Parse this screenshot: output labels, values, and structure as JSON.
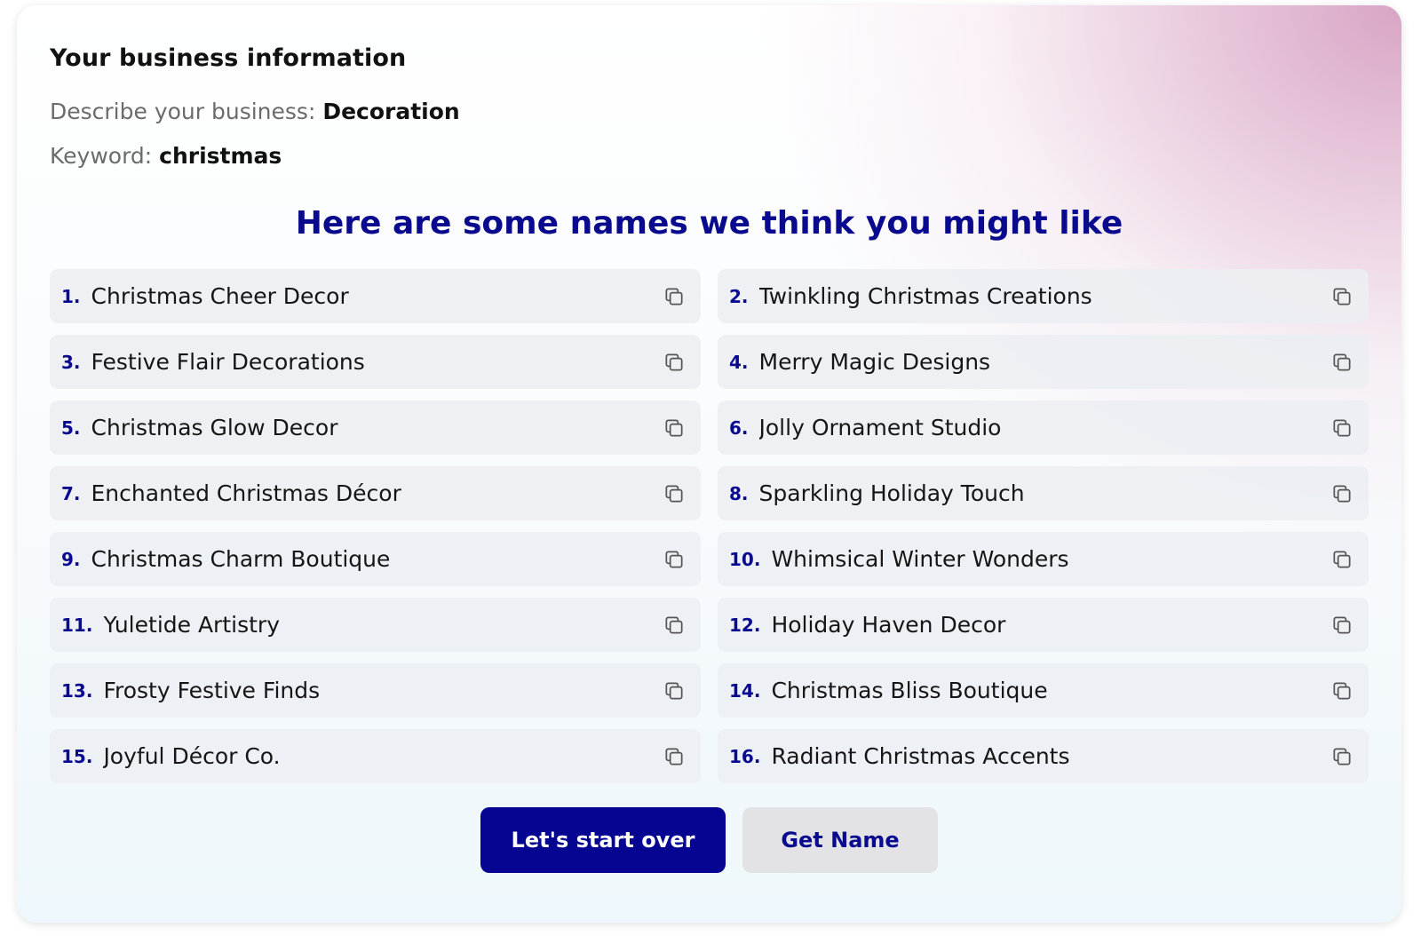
{
  "business": {
    "title": "Your business information",
    "describe_label": "Describe your business:",
    "describe_value": "Decoration",
    "keyword_label": "Keyword:",
    "keyword_value": "christmas"
  },
  "headline": "Here are some names we think you might like",
  "names": [
    {
      "num": "1.",
      "name": "Christmas Cheer Decor"
    },
    {
      "num": "2.",
      "name": "Twinkling Christmas Creations"
    },
    {
      "num": "3.",
      "name": "Festive Flair Decorations"
    },
    {
      "num": "4.",
      "name": "Merry Magic Designs"
    },
    {
      "num": "5.",
      "name": "Christmas Glow Decor"
    },
    {
      "num": "6.",
      "name": "Jolly Ornament Studio"
    },
    {
      "num": "7.",
      "name": "Enchanted Christmas Décor"
    },
    {
      "num": "8.",
      "name": "Sparkling Holiday Touch"
    },
    {
      "num": "9.",
      "name": "Christmas Charm Boutique"
    },
    {
      "num": "10.",
      "name": "Whimsical Winter Wonders"
    },
    {
      "num": "11.",
      "name": "Yuletide Artistry"
    },
    {
      "num": "12.",
      "name": "Holiday Haven Decor"
    },
    {
      "num": "13.",
      "name": "Frosty Festive Finds"
    },
    {
      "num": "14.",
      "name": "Christmas Bliss Boutique"
    },
    {
      "num": "15.",
      "name": "Joyful Décor Co."
    },
    {
      "num": "16.",
      "name": "Radiant Christmas Accents"
    }
  ],
  "buttons": {
    "start_over": "Let's start over",
    "get_name": "Get Name"
  },
  "icons": {
    "copy": "copy-icon"
  },
  "colors": {
    "accent": "#0a0a8f",
    "primary_button": "#050591",
    "secondary_button": "#e3e3e6"
  }
}
